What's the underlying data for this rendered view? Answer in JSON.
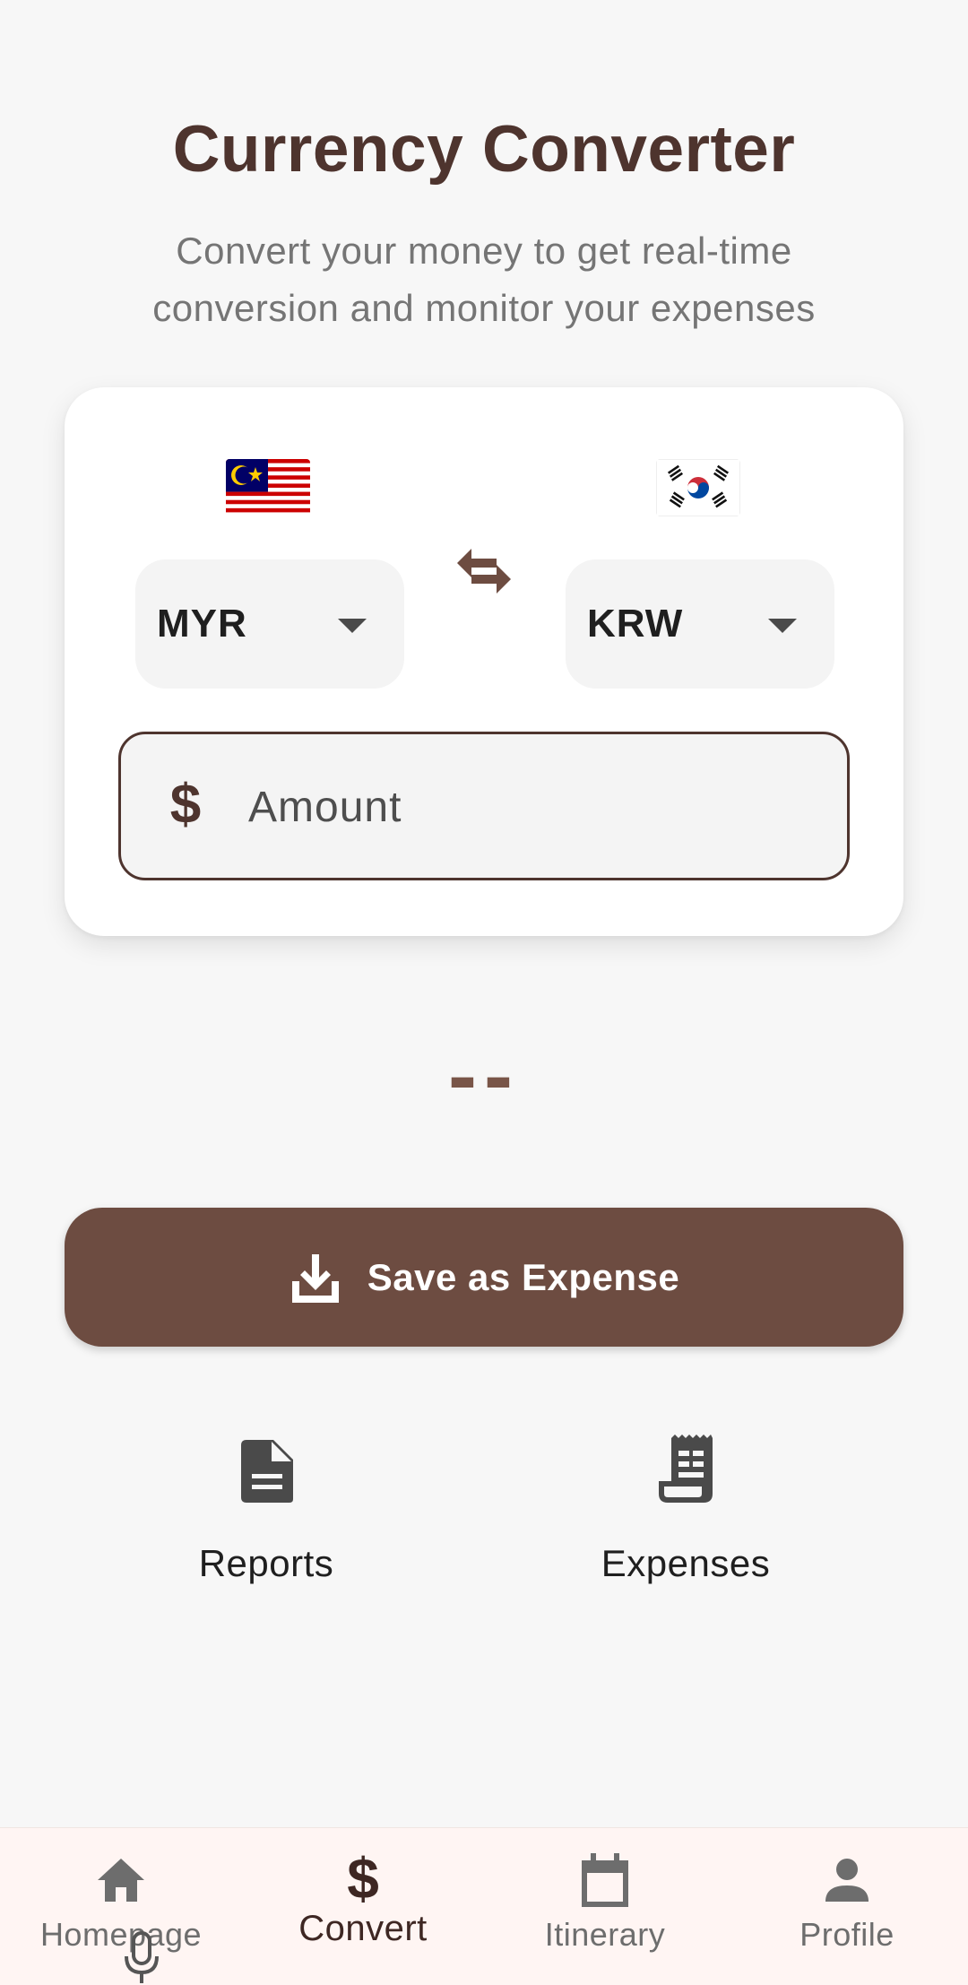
{
  "header": {
    "title": "Currency Converter",
    "subtitle": "Convert your money to get real-time conversion and monitor your expenses"
  },
  "converter": {
    "from_currency": "MYR",
    "to_currency": "KRW",
    "from_flag": "malaysia-flag-icon",
    "to_flag": "south-korea-flag-icon",
    "swap_icon": "swap-horizontal-icon",
    "amount": {
      "placeholder": "Amount",
      "value": "",
      "icon": "dollar-icon"
    }
  },
  "result": {
    "text": "--"
  },
  "actions": {
    "save_label": "Save as Expense",
    "save_icon": "download-icon"
  },
  "quick_links": [
    {
      "label": "Reports",
      "icon": "document-icon"
    },
    {
      "label": "Expenses",
      "icon": "receipt-icon"
    }
  ],
  "bottom_nav": {
    "items": [
      {
        "label": "Homepage",
        "icon": "home-icon",
        "active": false
      },
      {
        "label": "Convert",
        "icon": "dollar-icon",
        "active": true
      },
      {
        "label": "Itinerary",
        "icon": "calendar-icon",
        "active": false
      },
      {
        "label": "Profile",
        "icon": "person-icon",
        "active": false
      }
    ]
  },
  "colors": {
    "primary": "#6d4c41",
    "title": "#4e342e",
    "background": "#f7f7f7",
    "nav_background": "#fff5f3"
  }
}
